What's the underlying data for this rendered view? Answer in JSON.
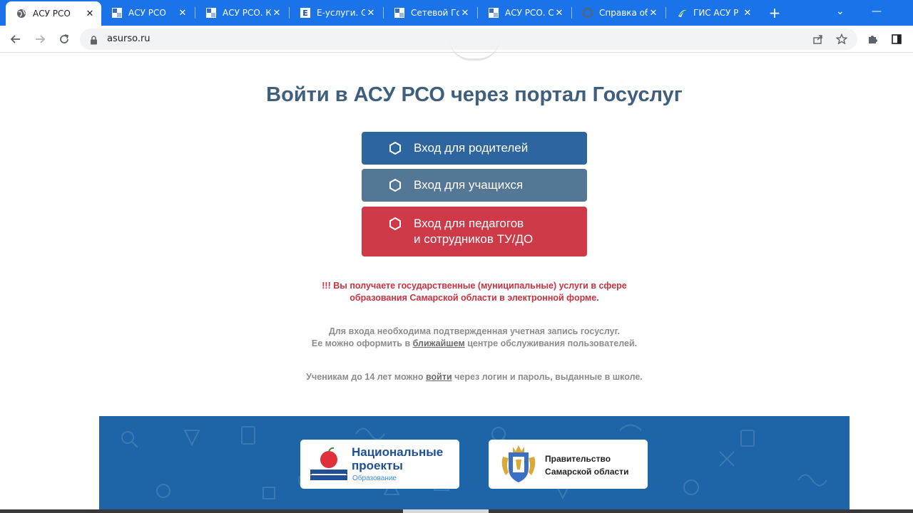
{
  "browser": {
    "tabs": [
      {
        "title": "АСУ РСО",
        "favicon": "globe-icon",
        "active": true
      },
      {
        "title": "АСУ РСО",
        "favicon": "grid-icon",
        "active": false
      },
      {
        "title": "АСУ РСО. К",
        "favicon": "grid-icon",
        "active": false
      },
      {
        "title": "Е-услуги. О",
        "favicon": "e-icon",
        "active": false
      },
      {
        "title": "Сетевой Го",
        "favicon": "grid-icon",
        "active": false
      },
      {
        "title": "АСУ РСО. С",
        "favicon": "grid-icon",
        "active": false
      },
      {
        "title": "Справка об",
        "favicon": "gear-icon",
        "active": false
      },
      {
        "title": "ГИС АСУ Р",
        "favicon": "gis-icon",
        "active": false
      }
    ],
    "url": "asurso.ru",
    "tab_bar_color": "#1a73e8"
  },
  "page": {
    "heading": "Войти в АСУ РСО через портал Госуслуг",
    "buttons": {
      "parents": "Вход для родителей",
      "students": "Вход для учащихся",
      "teachers_line1": "Вход для педагогов",
      "teachers_line2": "и сотрудников ТУ/ДО"
    },
    "colors": {
      "parents": "#2d659e",
      "students": "#557796",
      "teachers": "#cf3a48",
      "footer": "#1d65a8"
    },
    "notice_red_line1": "!!! Вы получаете государственные (муниципальные) услуги в сфере",
    "notice_red_line2": "образования Самарской области в электронной форме.",
    "notice_grey_line1": "Для входа необходима подтвержденная учетная запись госуслуг.",
    "notice_grey_line2_pre": "Ее можно оформить в ",
    "notice_grey_line2_link": "ближайшем",
    "notice_grey_line2_post": " центре обслуживания пользователей.",
    "notice_kids_pre": "Ученикам до 14 лет можно ",
    "notice_kids_link": "войти",
    "notice_kids_post": " через логин и пароль, выданные в школе."
  },
  "footer": {
    "national_projects": {
      "line1": "Национальные",
      "line2": "проекты",
      "line3": "Образование"
    },
    "government": {
      "line1": "Правительство",
      "line2": "Самарской области"
    }
  }
}
